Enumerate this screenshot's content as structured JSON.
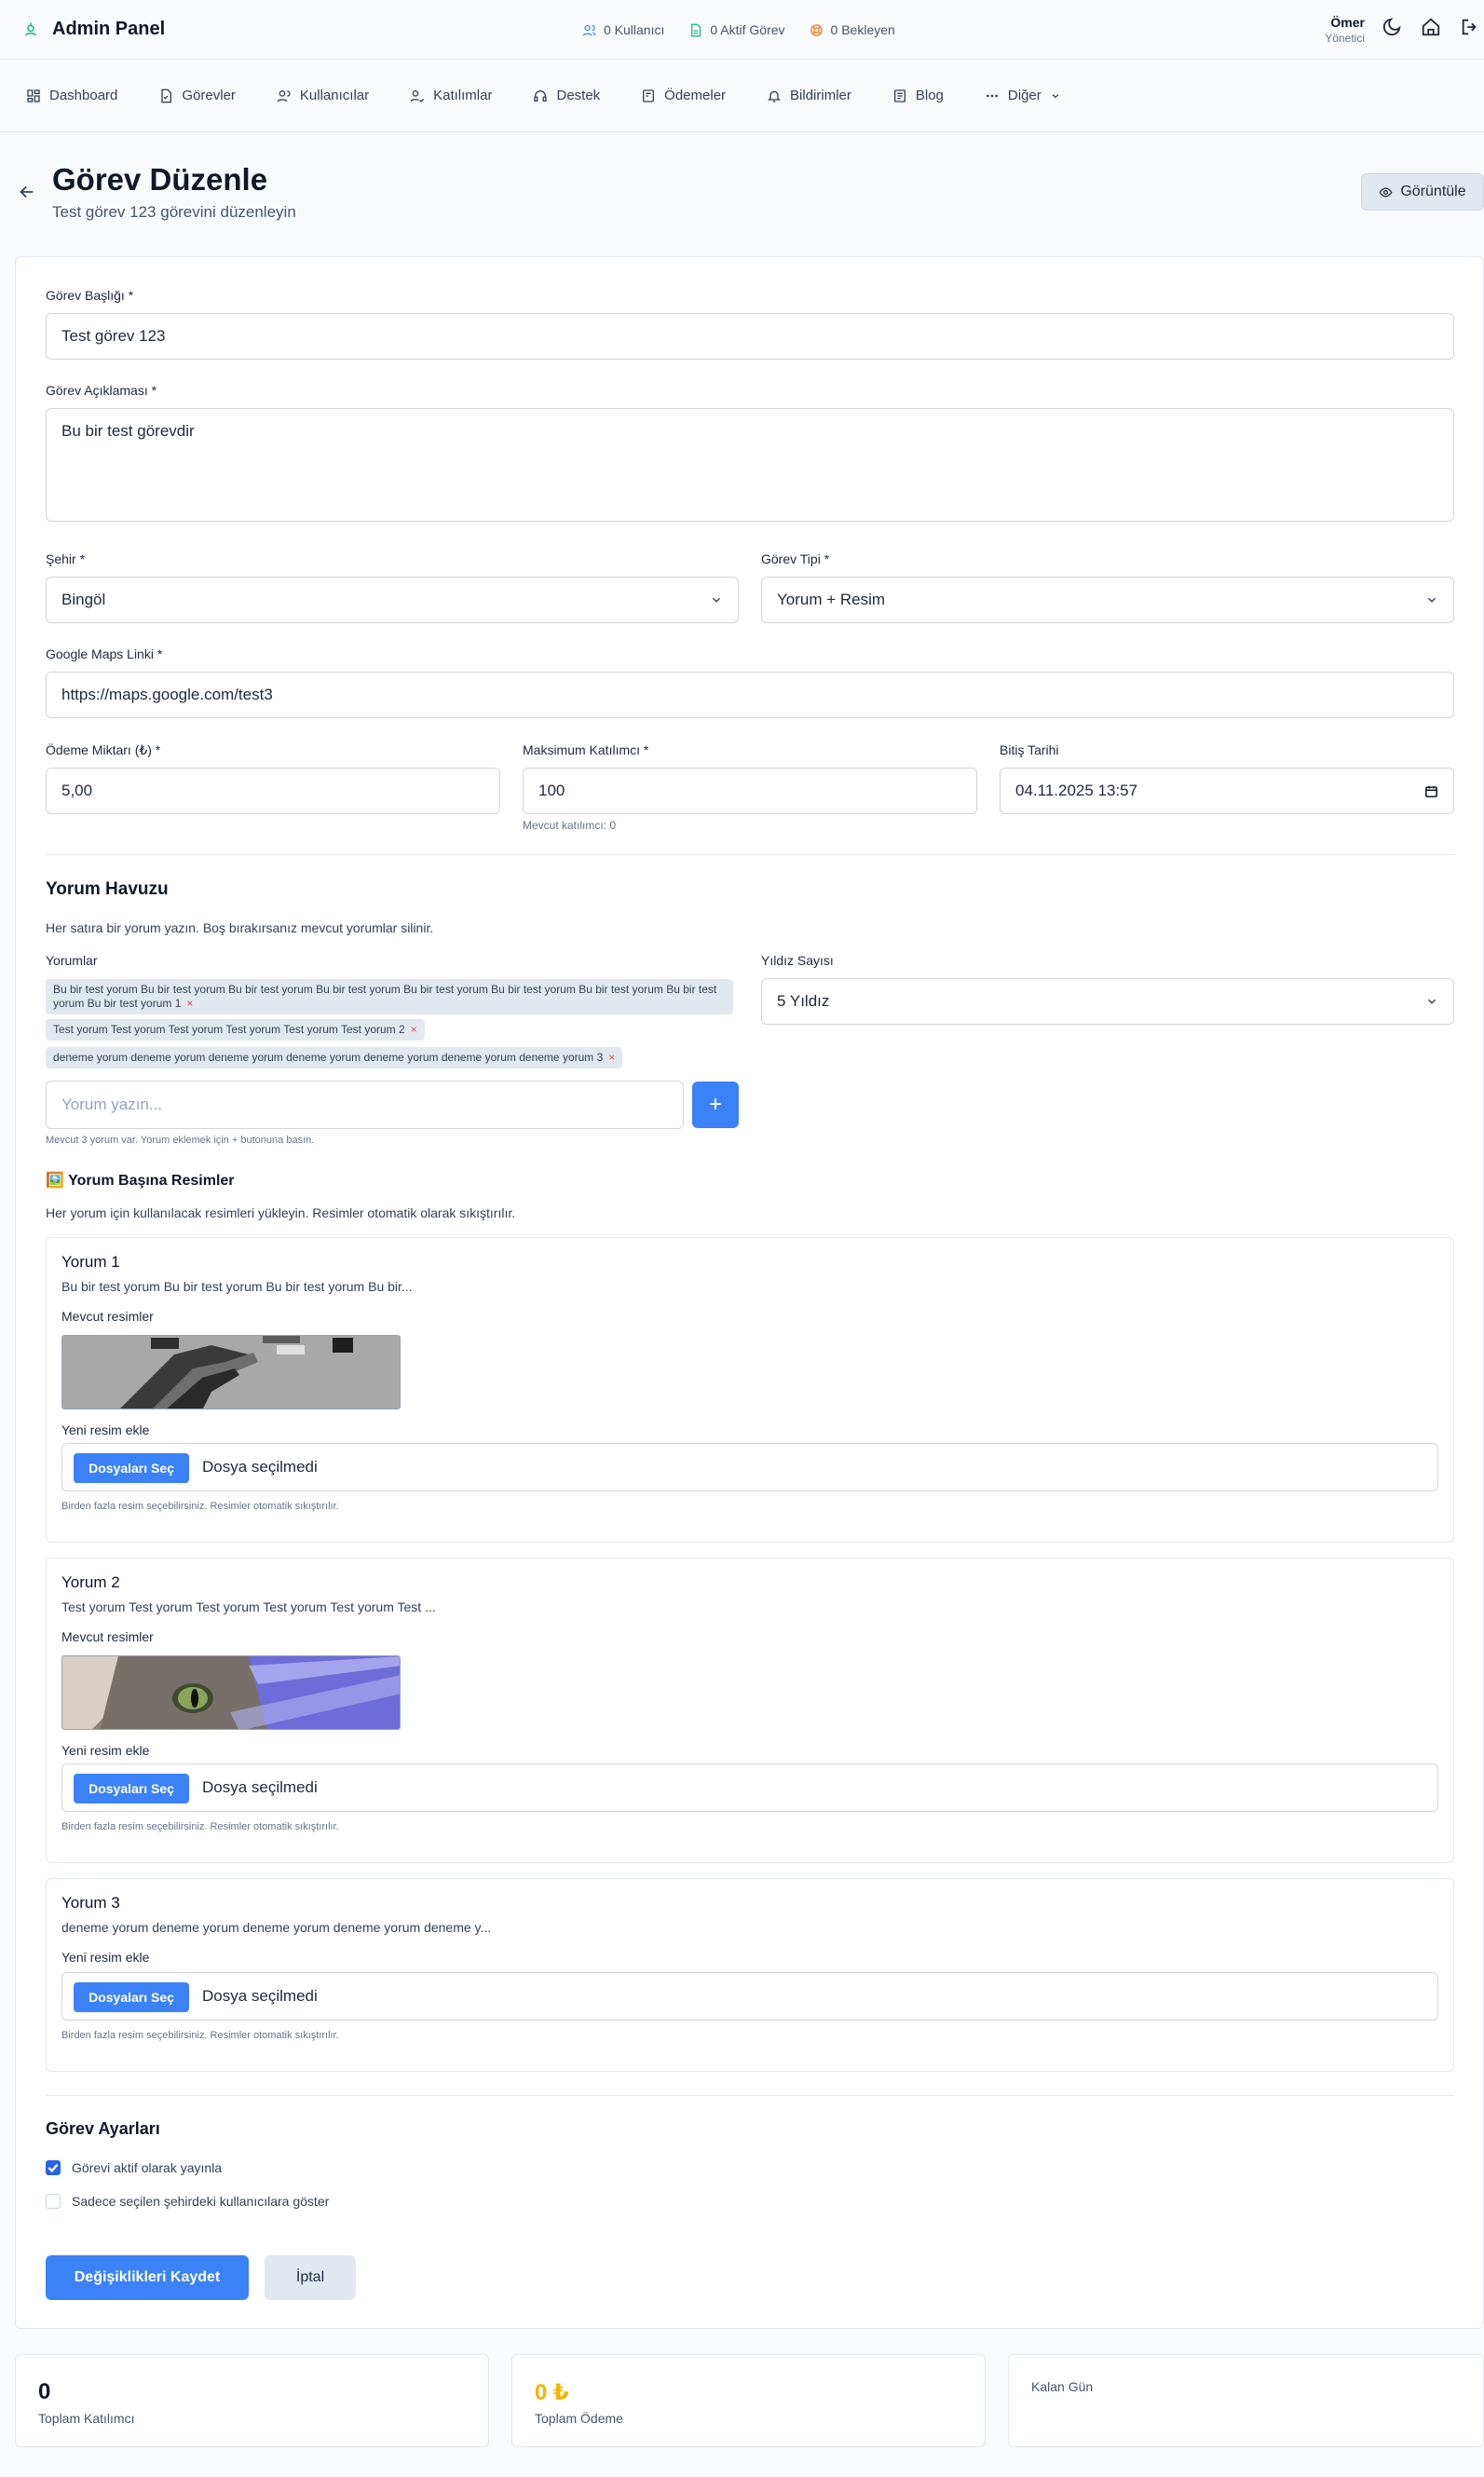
{
  "topbar": {
    "app_title": "Admin Panel",
    "stats": [
      {
        "label": "0 Kullanıcı",
        "icon": "users-icon",
        "color": "#3b82f6"
      },
      {
        "label": "0 Aktif Görev",
        "icon": "document-icon",
        "color": "#10b981"
      },
      {
        "label": "0 Bekleyen",
        "icon": "support-icon",
        "color": "#f97316"
      }
    ],
    "user_name": "Ömer",
    "user_role": "Yönetici"
  },
  "nav": {
    "items": [
      {
        "label": "Dashboard",
        "icon": "dashboard-icon"
      },
      {
        "label": "Görevler",
        "icon": "tasks-icon"
      },
      {
        "label": "Kullanıcılar",
        "icon": "users-icon"
      },
      {
        "label": "Katılımlar",
        "icon": "participation-icon"
      },
      {
        "label": "Destek",
        "icon": "support-icon"
      },
      {
        "label": "Ödemeler",
        "icon": "payments-icon"
      },
      {
        "label": "Bildirimler",
        "icon": "bell-icon"
      },
      {
        "label": "Blog",
        "icon": "blog-icon"
      },
      {
        "label": "Diğer",
        "icon": "more-icon"
      }
    ]
  },
  "header": {
    "title": "Görev Düzenle",
    "subtitle": "Test görev 123 görevini düzenleyin",
    "view_button": "Görüntüle"
  },
  "form": {
    "title_label": "Görev Başlığı *",
    "title_value": "Test görev 123",
    "desc_label": "Görev Açıklaması *",
    "desc_value": "Bu bir test görevdir",
    "city_label": "Şehir *",
    "city_value": "Bingöl",
    "type_label": "Görev Tipi *",
    "type_value": "Yorum + Resim",
    "maps_label": "Google Maps Linki *",
    "maps_value": "https://maps.google.com/test3",
    "amount_label": "Ödeme Miktarı (₺) *",
    "amount_value": "5,00",
    "max_label": "Maksimum Katılımcı *",
    "max_value": "100",
    "max_hint": "Mevcut katılımcı: 0",
    "end_label": "Bitiş Tarihi",
    "end_value": "04.11.2025 13:57"
  },
  "comments": {
    "section_title": "Yorum Havuzu",
    "help": "Her satıra bir yorum yazın. Boş bırakırsanız mevcut yorumlar silinir.",
    "list_label": "Yorumlar",
    "chips": [
      "Bu bir test yorum Bu bir test yorum Bu bir test yorum Bu bir test yorum Bu bir test yorum Bu bir test yorum Bu bir test yorum Bu bir test yorum Bu bir test yorum 1",
      "Test yorum Test yorum Test yorum Test yorum Test yorum Test yorum 2",
      "deneme yorum deneme yorum deneme yorum deneme yorum deneme yorum deneme yorum deneme yorum 3"
    ],
    "remove_glyph": "×",
    "input_placeholder": "Yorum yazın...",
    "add_glyph": "+",
    "count_hint": "Mevcut 3 yorum var. Yorum eklemek için + butonuna basın.",
    "stars_label": "Yıldız Sayısı",
    "stars_value": "5 Yıldız"
  },
  "images": {
    "emoji": "🖼️",
    "section_title": "Yorum Başına Resimler",
    "help": "Her yorum için kullanılacak resimleri yükleyin. Resimler otomatik olarak sıkıştırılır.",
    "existing_label": "Mevcut resimler",
    "new_label": "Yeni resim ekle",
    "choose_button": "Dosyaları Seç",
    "no_file": "Dosya seçilmedi",
    "hint": "Birden fazla resim seçebilirsiniz. Resimler otomatik sıkıştırılır.",
    "blocks": [
      {
        "title": "Yorum 1",
        "preview": "Bu bir test yorum Bu bir test yorum Bu bir test yorum Bu bir..."
      },
      {
        "title": "Yorum 2",
        "preview": "Test yorum Test yorum Test yorum Test yorum Test yorum Test ..."
      },
      {
        "title": "Yorum 3",
        "preview": "deneme yorum deneme yorum deneme yorum deneme yorum deneme y..."
      }
    ]
  },
  "settings": {
    "section_title": "Görev Ayarları",
    "active_label": "Görevi aktif olarak yayınla",
    "active_checked": true,
    "city_only_label": "Sadece seçilen şehirdeki kullanıcılara göster",
    "city_only_checked": false
  },
  "actions": {
    "save": "Değişiklikleri Kaydet",
    "cancel": "İptal"
  },
  "stats": {
    "participants_value": "0",
    "participants_label": "Toplam Katılımcı",
    "payment_value": "0 ₺",
    "payment_label": "Toplam Ödeme",
    "payment_color": "#f5b400",
    "days_label": "Kalan Gün"
  }
}
